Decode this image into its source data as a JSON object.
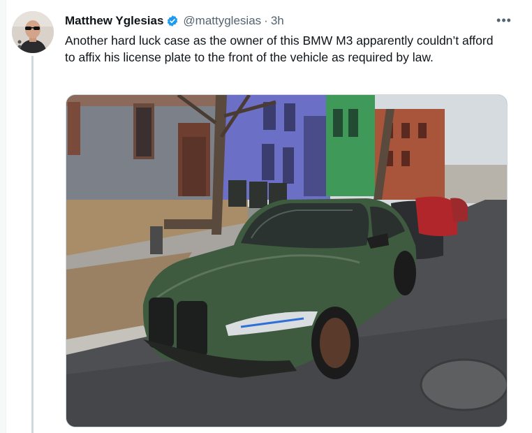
{
  "tweet": {
    "display_name": "Matthew Yglesias",
    "handle": "@mattyglesias",
    "separator": "·",
    "time": "3h",
    "more_label": "•••",
    "text": "Another hard luck case as the owner of this BMW M3 apparently couldn’t afford to affix his license plate to the front of the vehicle as required by law."
  },
  "icons": {
    "verified": "verified-badge-icon",
    "more": "more-options-icon"
  },
  "colors": {
    "verified_blue": "#1d9bf0",
    "secondary_text": "#536471",
    "primary_text": "#0f1419",
    "car_green": "#3e5a3f"
  }
}
